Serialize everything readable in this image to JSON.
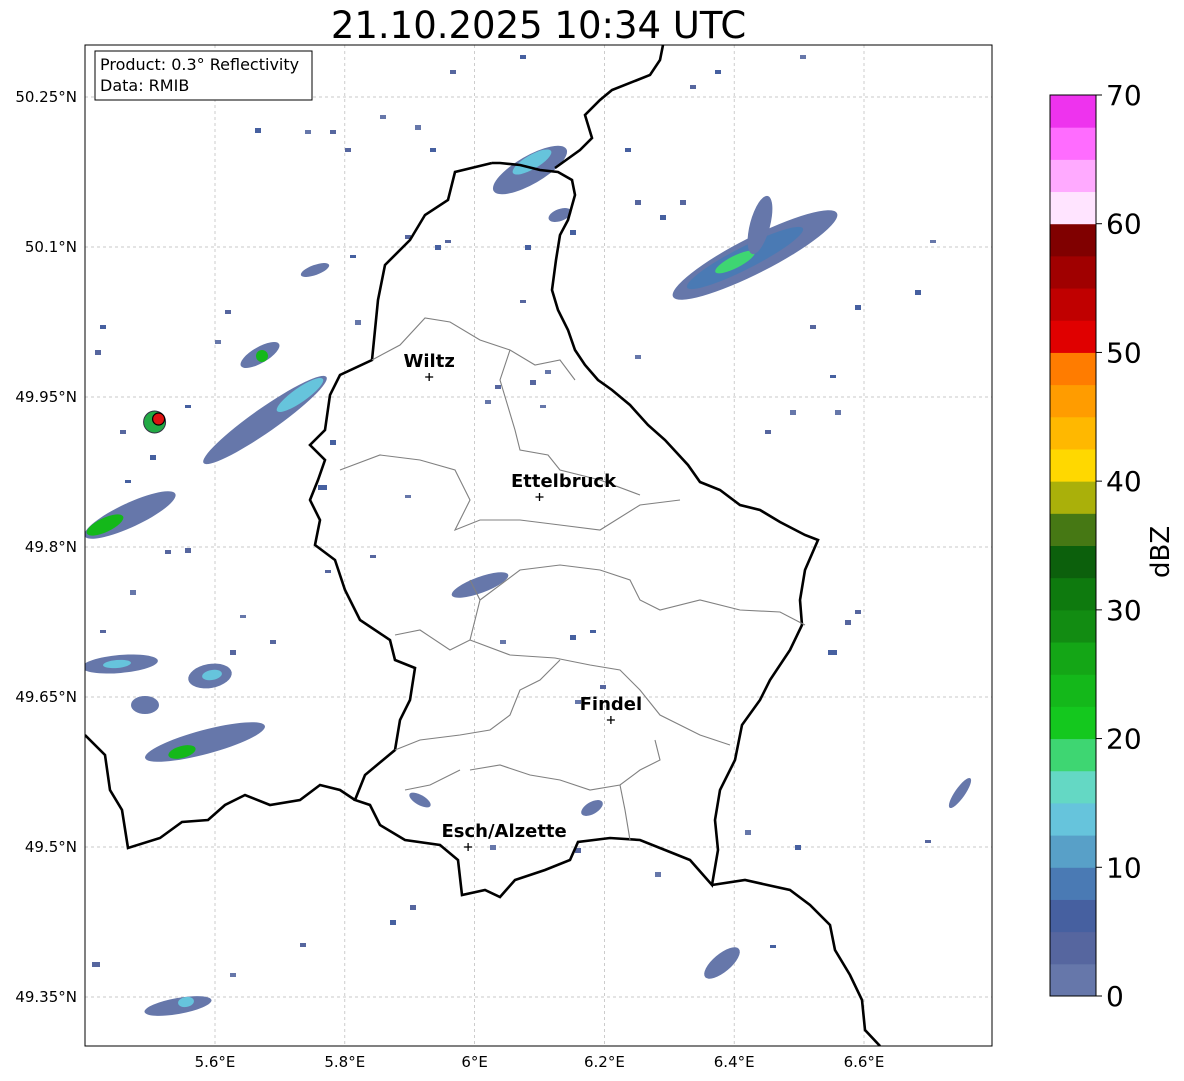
{
  "title": "21.10.2025 10:34 UTC",
  "info_box": {
    "line1": "Product: 0.3° Reflectivity",
    "line2": "Data: RMIB"
  },
  "map": {
    "lon_ticks": [
      "5.6°E",
      "5.8°E",
      "6°E",
      "6.2°E",
      "6.4°E",
      "6.6°E"
    ],
    "lat_ticks": [
      "50.25°N",
      "50.1°N",
      "49.95°N",
      "49.8°N",
      "49.65°N",
      "49.5°N",
      "49.35°N"
    ],
    "cities": [
      {
        "name": "Wiltz",
        "lon": 5.93,
        "lat": 49.97
      },
      {
        "name": "Ettelbruck",
        "lon": 6.1,
        "lat": 49.85
      },
      {
        "name": "Findel",
        "lon": 6.21,
        "lat": 49.627
      },
      {
        "name": "Esch/Alzette",
        "lon": 5.99,
        "lat": 49.5
      }
    ],
    "radar_site_color": "#dd1111"
  },
  "colorbar": {
    "label": "dBZ",
    "ticks": [
      "70",
      "60",
      "50",
      "40",
      "30",
      "20",
      "10",
      "0"
    ],
    "colors_bottom_to_top": [
      "#6677aa",
      "#56669f",
      "#4660a0",
      "#4a7ab4",
      "#58a0c8",
      "#66c4dc",
      "#64d8c4",
      "#3ed672",
      "#14c81e",
      "#14b81a",
      "#14a616",
      "#128c12",
      "#0e7a0e",
      "#0c600c",
      "#467814",
      "#aab00a",
      "#ffd800",
      "#ffb800",
      "#ff9c00",
      "#ff7c00",
      "#e00000",
      "#c00000",
      "#a00000",
      "#800000",
      "#ffe4ff",
      "#ffaaff",
      "#ff6cff",
      "#ee33ee"
    ]
  }
}
